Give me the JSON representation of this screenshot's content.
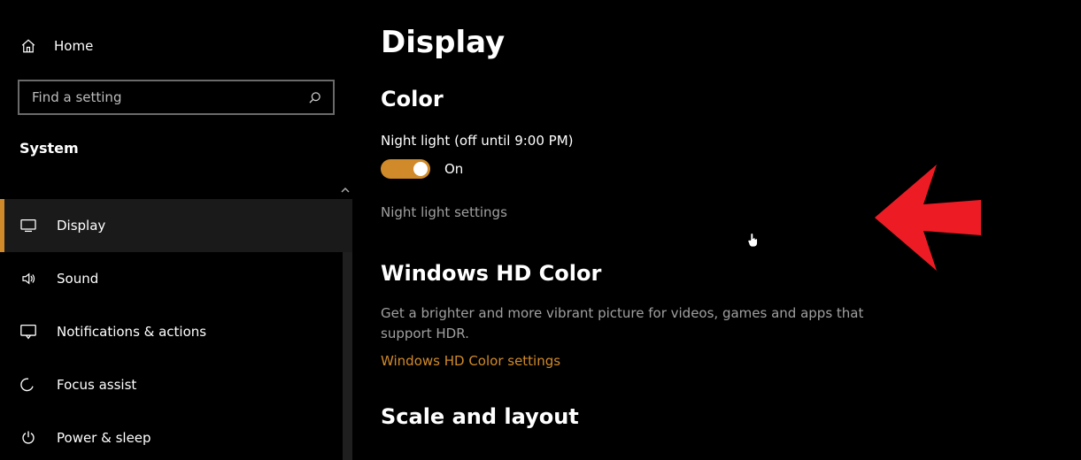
{
  "sidebar": {
    "home_label": "Home",
    "search_placeholder": "Find a setting",
    "section_title": "System",
    "items": [
      {
        "label": "Display"
      },
      {
        "label": "Sound"
      },
      {
        "label": "Notifications & actions"
      },
      {
        "label": "Focus assist"
      },
      {
        "label": "Power & sleep"
      }
    ]
  },
  "main": {
    "page_title": "Display",
    "color": {
      "heading": "Color",
      "night_light_label": "Night light (off until 9:00 PM)",
      "toggle_state": "On",
      "settings_link": "Night light settings"
    },
    "hdr": {
      "heading": "Windows HD Color",
      "description": "Get a brighter and more vibrant picture for videos, games and apps that support HDR.",
      "link": "Windows HD Color settings"
    },
    "scale": {
      "heading_cut": "Scale and layout"
    }
  },
  "colors": {
    "accent": "#d08a2a"
  }
}
